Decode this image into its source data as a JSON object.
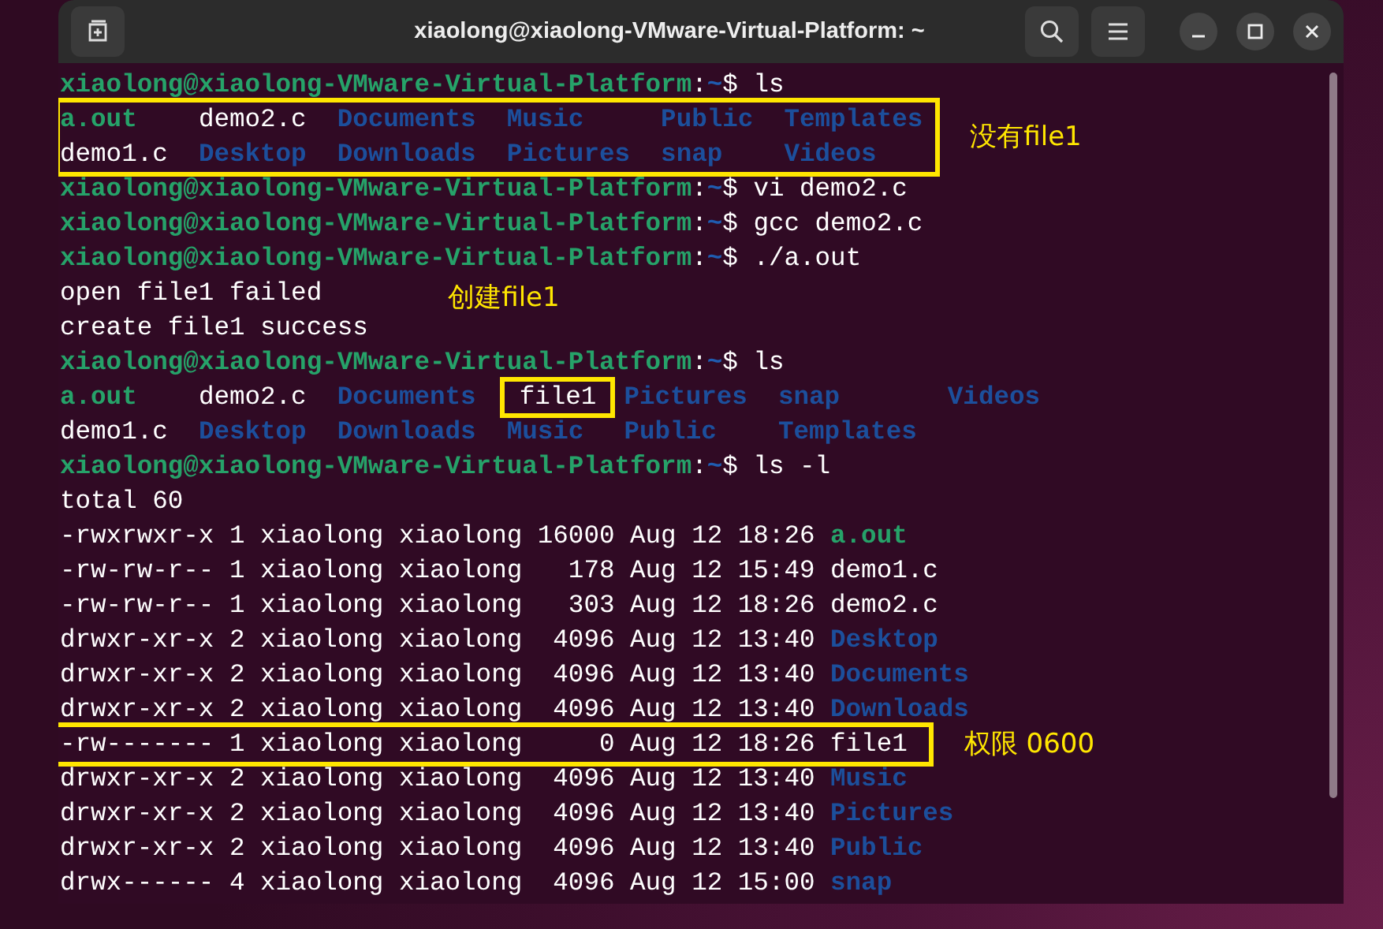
{
  "window": {
    "title": "xiaolong@xiaolong-VMware-Virtual-Platform: ~"
  },
  "terminal": {
    "lines": [
      {
        "kind": "prompt",
        "user_host": "xiaolong@xiaolong-VMware-Virtual-Platform",
        "colon": ":",
        "path": "~",
        "sign": "$",
        "command": "ls",
        "boxed": false
      },
      {
        "kind": "ls",
        "boxed": true,
        "note": "没有file1",
        "rows": [
          [
            {
              "name": "a.out",
              "kind": "exec",
              "boxed": false
            },
            {
              "name": "demo2.c",
              "kind": "file",
              "boxed": false
            },
            {
              "name": "Documents",
              "kind": "dir",
              "boxed": false
            },
            {
              "name": "Music",
              "kind": "dir",
              "boxed": false
            },
            {
              "name": "Public",
              "kind": "dir",
              "boxed": false
            },
            {
              "name": "Templates",
              "kind": "dir",
              "boxed": false
            }
          ],
          [
            {
              "name": "demo1.c",
              "kind": "file",
              "boxed": false
            },
            {
              "name": "Desktop",
              "kind": "dir",
              "boxed": false
            },
            {
              "name": "Downloads",
              "kind": "dir",
              "boxed": false
            },
            {
              "name": "Pictures",
              "kind": "dir",
              "boxed": false
            },
            {
              "name": "snap",
              "kind": "dir",
              "boxed": false
            },
            {
              "name": "Videos",
              "kind": "dir",
              "boxed": false
            }
          ]
        ]
      },
      {
        "kind": "prompt",
        "user_host": "xiaolong@xiaolong-VMware-Virtual-Platform",
        "colon": ":",
        "path": "~",
        "sign": "$",
        "command": "vi demo2.c",
        "boxed": false
      },
      {
        "kind": "prompt",
        "user_host": "xiaolong@xiaolong-VMware-Virtual-Platform",
        "colon": ":",
        "path": "~",
        "sign": "$",
        "command": "gcc demo2.c",
        "boxed": false
      },
      {
        "kind": "prompt",
        "user_host": "xiaolong@xiaolong-VMware-Virtual-Platform",
        "colon": ":",
        "path": "~",
        "sign": "$",
        "command": "./a.out",
        "boxed": false
      },
      {
        "kind": "output",
        "text": "open file1 failed",
        "boxed": false,
        "note": "创建file1"
      },
      {
        "kind": "output",
        "text": "create file1 success",
        "boxed": false
      },
      {
        "kind": "prompt",
        "user_host": "xiaolong@xiaolong-VMware-Virtual-Platform",
        "colon": ":",
        "path": "~",
        "sign": "$",
        "command": "ls",
        "boxed": false
      },
      {
        "kind": "ls",
        "boxed": false,
        "rows": [
          [
            {
              "name": "a.out",
              "kind": "exec",
              "boxed": false
            },
            {
              "name": "demo2.c",
              "kind": "file",
              "boxed": false
            },
            {
              "name": "Documents",
              "kind": "dir",
              "boxed": false
            },
            {
              "name": "file1",
              "kind": "file",
              "boxed": true
            },
            {
              "name": "Pictures",
              "kind": "dir",
              "boxed": false
            },
            {
              "name": "snap",
              "kind": "dir",
              "boxed": false
            },
            {
              "name": "Videos",
              "kind": "dir",
              "boxed": false
            }
          ],
          [
            {
              "name": "demo1.c",
              "kind": "file",
              "boxed": false
            },
            {
              "name": "Desktop",
              "kind": "dir",
              "boxed": false
            },
            {
              "name": "Downloads",
              "kind": "dir",
              "boxed": false
            },
            {
              "name": "Music",
              "kind": "dir",
              "boxed": false
            },
            {
              "name": "Public",
              "kind": "dir",
              "boxed": false
            },
            {
              "name": "Templates",
              "kind": "dir",
              "boxed": false
            }
          ]
        ]
      },
      {
        "kind": "prompt",
        "user_host": "xiaolong@xiaolong-VMware-Virtual-Platform",
        "colon": ":",
        "path": "~",
        "sign": "$",
        "command": "ls -l",
        "boxed": false
      },
      {
        "kind": "output",
        "text": "total 60",
        "boxed": false
      },
      {
        "kind": "long",
        "meta": "-rwxrwxr-x 1 xiaolong xiaolong 16000 Aug 12 18:26",
        "file": {
          "name": "a.out",
          "kind": "exec"
        },
        "boxed": false
      },
      {
        "kind": "long",
        "meta": "-rw-rw-r-- 1 xiaolong xiaolong   178 Aug 12 15:49",
        "file": {
          "name": "demo1.c",
          "kind": "file"
        },
        "boxed": false
      },
      {
        "kind": "long",
        "meta": "-rw-rw-r-- 1 xiaolong xiaolong   303 Aug 12 18:26",
        "file": {
          "name": "demo2.c",
          "kind": "file"
        },
        "boxed": false
      },
      {
        "kind": "long",
        "meta": "drwxr-xr-x 2 xiaolong xiaolong  4096 Aug 12 13:40",
        "file": {
          "name": "Desktop",
          "kind": "dir"
        },
        "boxed": false
      },
      {
        "kind": "long",
        "meta": "drwxr-xr-x 2 xiaolong xiaolong  4096 Aug 12 13:40",
        "file": {
          "name": "Documents",
          "kind": "dir"
        },
        "boxed": false
      },
      {
        "kind": "long",
        "meta": "drwxr-xr-x 2 xiaolong xiaolong  4096 Aug 12 13:40",
        "file": {
          "name": "Downloads",
          "kind": "dir"
        },
        "boxed": false
      },
      {
        "kind": "long",
        "meta": "-rw------- 1 xiaolong xiaolong     0 Aug 12 18:26",
        "file": {
          "name": "file1",
          "kind": "file"
        },
        "boxed": true,
        "note": "权限 0600"
      },
      {
        "kind": "long",
        "meta": "drwxr-xr-x 2 xiaolong xiaolong  4096 Aug 12 13:40",
        "file": {
          "name": "Music",
          "kind": "dir"
        },
        "boxed": false
      },
      {
        "kind": "long",
        "meta": "drwxr-xr-x 2 xiaolong xiaolong  4096 Aug 12 13:40",
        "file": {
          "name": "Pictures",
          "kind": "dir"
        },
        "boxed": false
      },
      {
        "kind": "long",
        "meta": "drwxr-xr-x 2 xiaolong xiaolong  4096 Aug 12 13:40",
        "file": {
          "name": "Public",
          "kind": "dir"
        },
        "boxed": false
      },
      {
        "kind": "long",
        "meta": "drwx------ 4 xiaolong xiaolong  4096 Aug 12 15:00",
        "file": {
          "name": "snap",
          "kind": "dir"
        },
        "boxed": false
      }
    ]
  }
}
